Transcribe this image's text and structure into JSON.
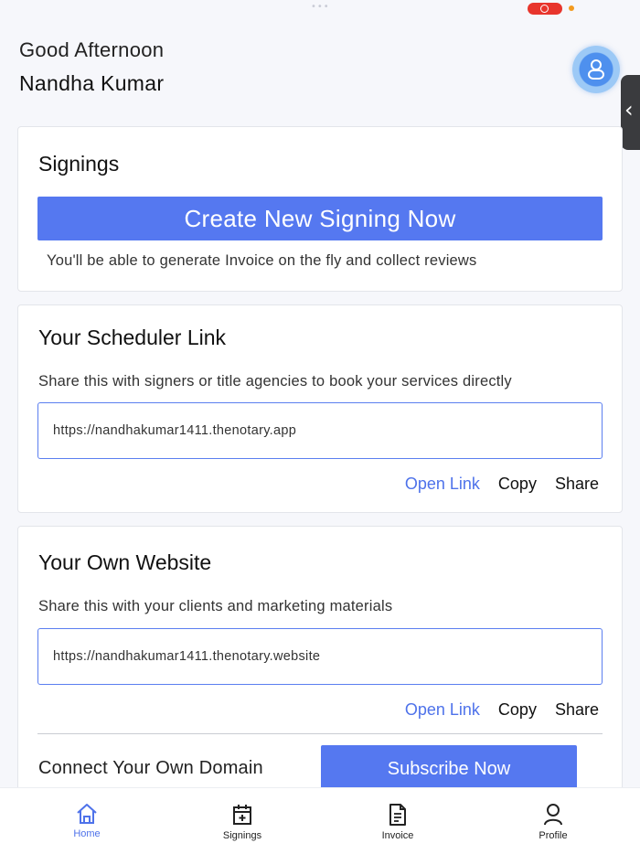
{
  "status_bar": {
    "left_text": "",
    "right_text": ""
  },
  "header": {
    "greeting": "Good Afternoon",
    "user_name": "Nandha Kumar",
    "avatar_icon": "user-icon",
    "side_handle_icon": "‹"
  },
  "signings_card": {
    "title": "Signings",
    "create_button": "Create New Signing Now",
    "note": "You'll be able to generate Invoice on the fly and collect reviews"
  },
  "scheduler_card": {
    "title": "Your Scheduler Link",
    "description": "Share this with signers or title agencies to book your services directly",
    "url": "https://nandhakumar1411.thenotary.app",
    "open_link": "Open Link",
    "copy": "Copy",
    "share": "Share"
  },
  "website_card": {
    "title": "Your Own Website",
    "description": "Share this with your clients and marketing materials",
    "url": "https://nandhakumar1411.thenotary.website",
    "open_link": "Open Link",
    "copy": "Copy",
    "share": "Share",
    "domain_label": "Connect Your Own Domain",
    "subscribe_button": "Subscribe Now"
  },
  "tabs": [
    {
      "label": "Home",
      "icon": "home-icon",
      "active": true
    },
    {
      "label": "Signings",
      "icon": "calendar-add-icon",
      "active": false
    },
    {
      "label": "Invoice",
      "icon": "document-icon",
      "active": false
    },
    {
      "label": "Profile",
      "icon": "person-icon",
      "active": false
    }
  ],
  "colors": {
    "accent": "#5578f0",
    "link": "#4e72ea",
    "recording": "#e8352c"
  }
}
